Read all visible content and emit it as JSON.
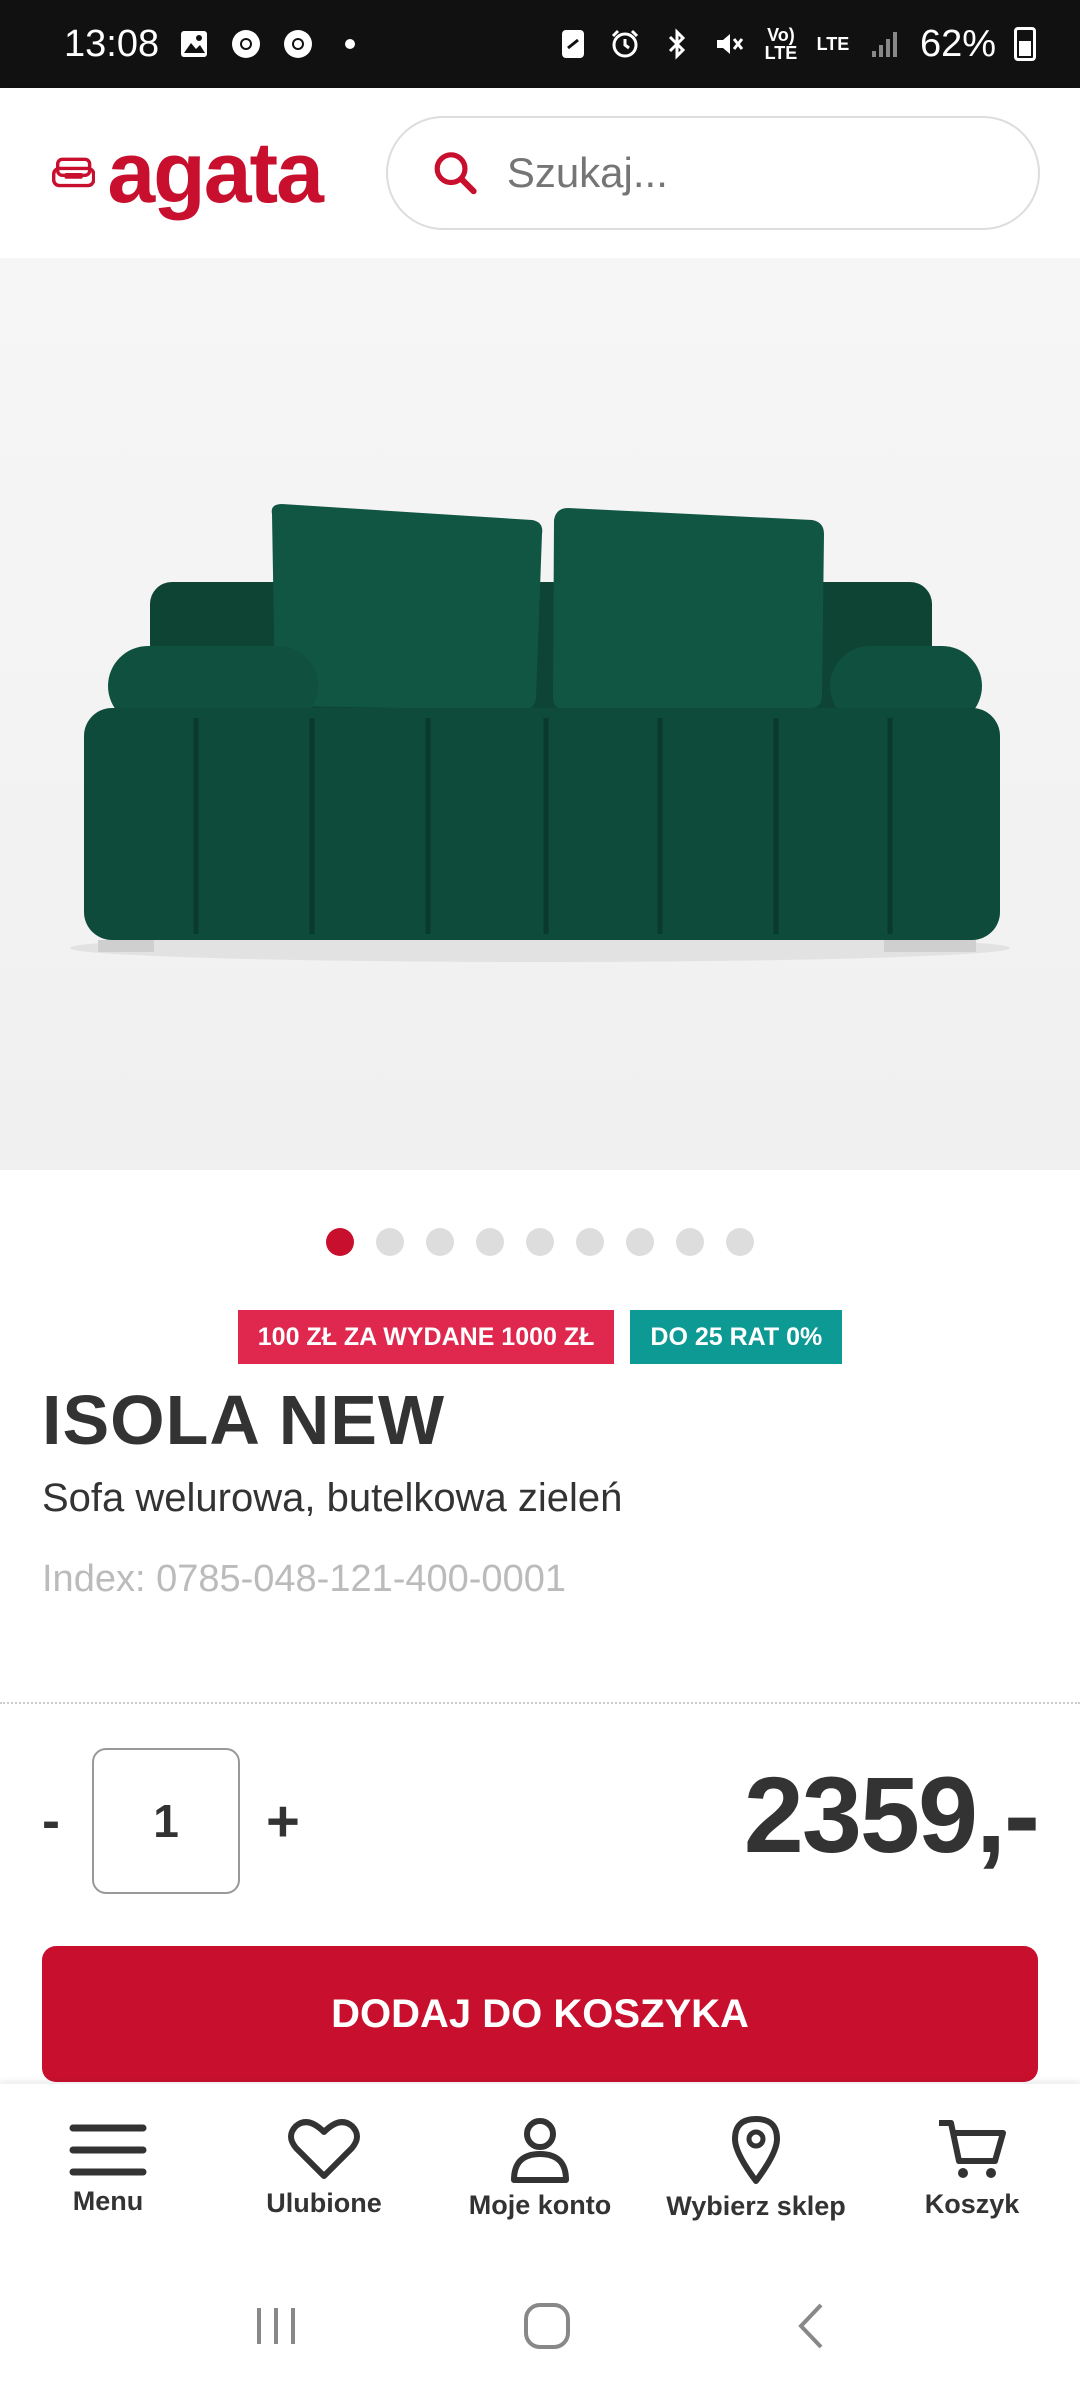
{
  "status_bar": {
    "time": "13:08",
    "battery": "62%",
    "network": "LTE",
    "volte": "Vo) LTE"
  },
  "header": {
    "logo_text": "agata",
    "search_placeholder": "Szukaj..."
  },
  "gallery": {
    "image": "green-velvet-sofa",
    "total_images": 9,
    "active_index": 0
  },
  "product": {
    "badge_promo": "100 ZŁ ZA WYDANE 1000 ZŁ",
    "badge_installments": "DO 25 RAT 0%",
    "name": "ISOLA NEW",
    "description": "Sofa welurowa, butelkowa zieleń",
    "index": "Index: 0785-048-121-400-0001",
    "quantity": "1",
    "qty_minus": "-",
    "qty_plus": "+",
    "price": "2359,-",
    "add_to_cart": "DODAJ DO KOSZYKA"
  },
  "bottom_nav": {
    "items": [
      {
        "label": "Menu",
        "icon": "hamburger-icon"
      },
      {
        "label": "Ulubione",
        "icon": "heart-icon"
      },
      {
        "label": "Moje konto",
        "icon": "user-icon"
      },
      {
        "label": "Wybierz sklep",
        "icon": "location-pin-icon"
      },
      {
        "label": "Koszyk",
        "icon": "cart-icon"
      }
    ]
  },
  "colors": {
    "brand_red": "#c8102e",
    "badge_red": "#e0284f",
    "badge_teal": "#0e9a94",
    "sofa_green": "#0f4a3a"
  }
}
